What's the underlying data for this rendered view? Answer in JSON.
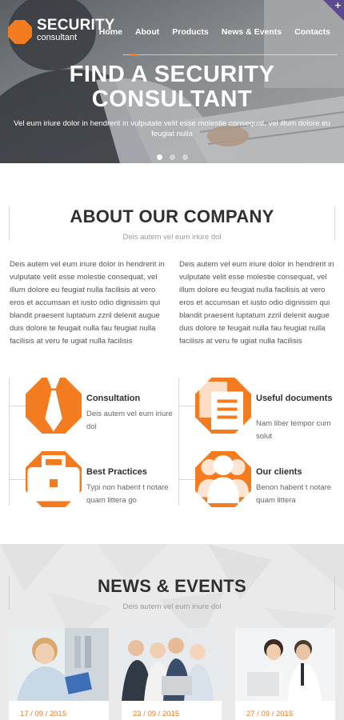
{
  "header": {
    "logo_title": "SECURITY",
    "logo_subtitle": "consultant",
    "nav": [
      "Home",
      "About",
      "Products",
      "News & Events",
      "Contacts"
    ],
    "corner_badge": "+"
  },
  "hero": {
    "title_line1": "FIND A SECURITY",
    "title_line2": "CONSULTANT",
    "text": "Vel eum iriure dolor in hendrerit in vulputate velit esse molestie consequat, vel illum dolore eu feugiat nulla",
    "slide_count": 3,
    "active_slide": 1
  },
  "about": {
    "title": "ABOUT OUR COMPANY",
    "subtitle": "Deis autem vel eum iriure dol",
    "column1": "Deis autem vel eum iriure dolor in hendrerit in vulputate velit esse molestie consequat, vel illum dolore eu feugiat nulla facilisis at vero eros et accumsan et iusto odio dignissim qui blandit praesent luptatum zzril delenit augue duis dolore te feugait nulla fau feugiat nulla facilisis at veru fe ugiat nulla facilisis",
    "column2": "Deis autem vel eum iriure dolor in hendrerit in vulputate velit esse molestie consequat, vel illum dolore eu feugiat nulla facilisis at vero eros et accumsan et iusto odio dignissim qui blandit praesent luptatum zzril delenit augue duis dolore te feugait nulla fau feugiat nulla facilisis at veru fe ugiat nulla facilisis"
  },
  "features": [
    {
      "title": "Consultation",
      "text": "Deis autem vel eum iriure dol",
      "icon": "tie-icon"
    },
    {
      "title": "Useful documents",
      "text": "Nam liber tempor cum solut",
      "icon": "documents-icon"
    },
    {
      "title": "Best Practices",
      "text": "Typi non habent t notare quam littera go",
      "icon": "briefcase-icon"
    },
    {
      "title": "Our clients",
      "text": "Benon habent t notare quam littera",
      "icon": "people-icon"
    }
  ],
  "news": {
    "title": "NEWS & EVENTS",
    "subtitle": "Deis autem vel eum iriure dol",
    "items": [
      {
        "date": "17 / 09 / 2015"
      },
      {
        "date": "23 / 09 / 2015"
      },
      {
        "date": "27 / 09 / 2015"
      }
    ]
  },
  "colors": {
    "accent": "#f47c20",
    "heading": "#2f2f2f",
    "badge": "#5b4a8f"
  }
}
